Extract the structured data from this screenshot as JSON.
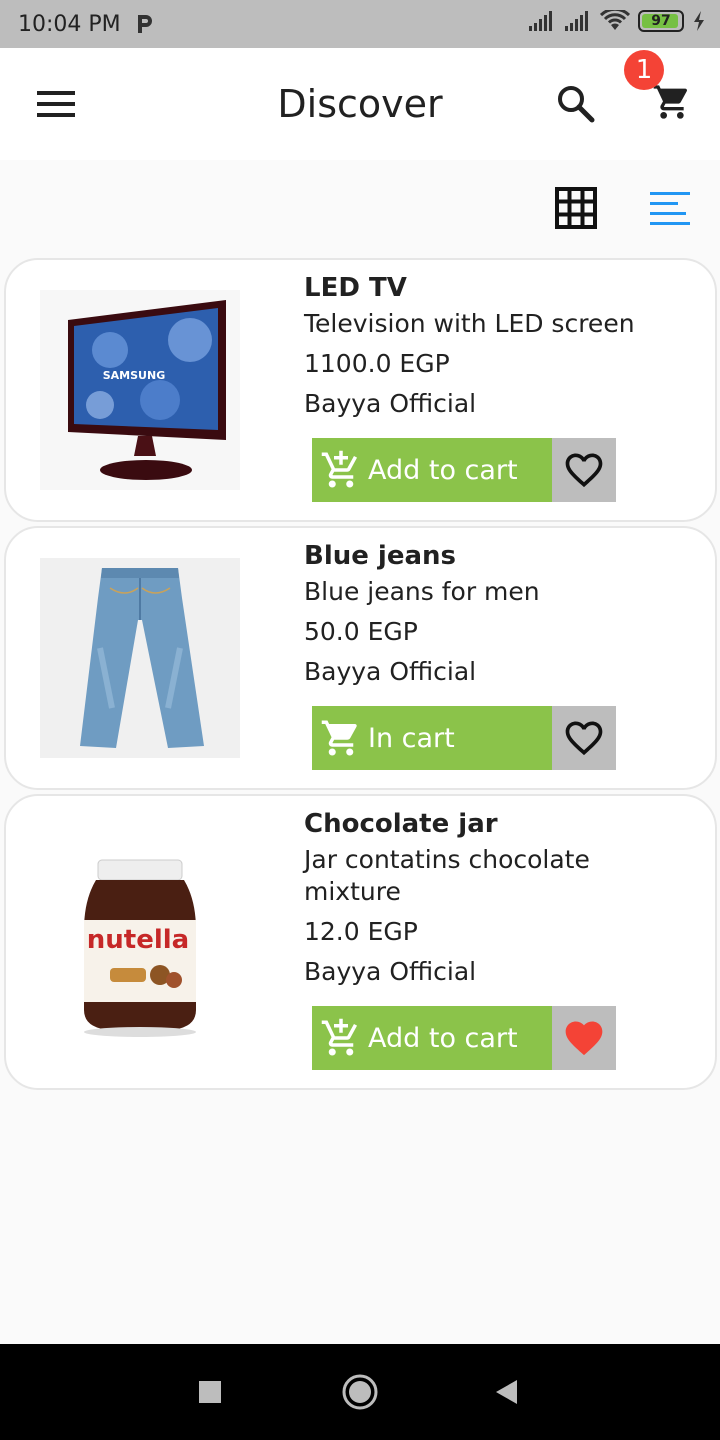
{
  "status_bar": {
    "time": "10:04 PM",
    "battery": "97"
  },
  "app_bar": {
    "title": "Discover",
    "cart_count": "1"
  },
  "products": [
    {
      "name": "LED TV",
      "description": "Television with LED screen",
      "price": "1100.0 EGP",
      "seller": "Bayya Official",
      "cart_label": "Add to cart",
      "in_cart": false,
      "favorite": false,
      "image_brand": "SAMSUNG"
    },
    {
      "name": "Blue jeans",
      "description": "Blue jeans for men",
      "price": "50.0 EGP",
      "seller": "Bayya Official",
      "cart_label": "In cart",
      "in_cart": true,
      "favorite": false
    },
    {
      "name": "Chocolate jar",
      "description": "Jar contatins chocolate mixture",
      "price": "12.0 EGP",
      "seller": "Bayya Official",
      "cart_label": "Add to cart",
      "in_cart": false,
      "favorite": true,
      "image_brand": "nutella"
    }
  ],
  "colors": {
    "accent_green": "#8bc34a",
    "favorite_red": "#f44336",
    "list_view_blue": "#2196f3"
  }
}
